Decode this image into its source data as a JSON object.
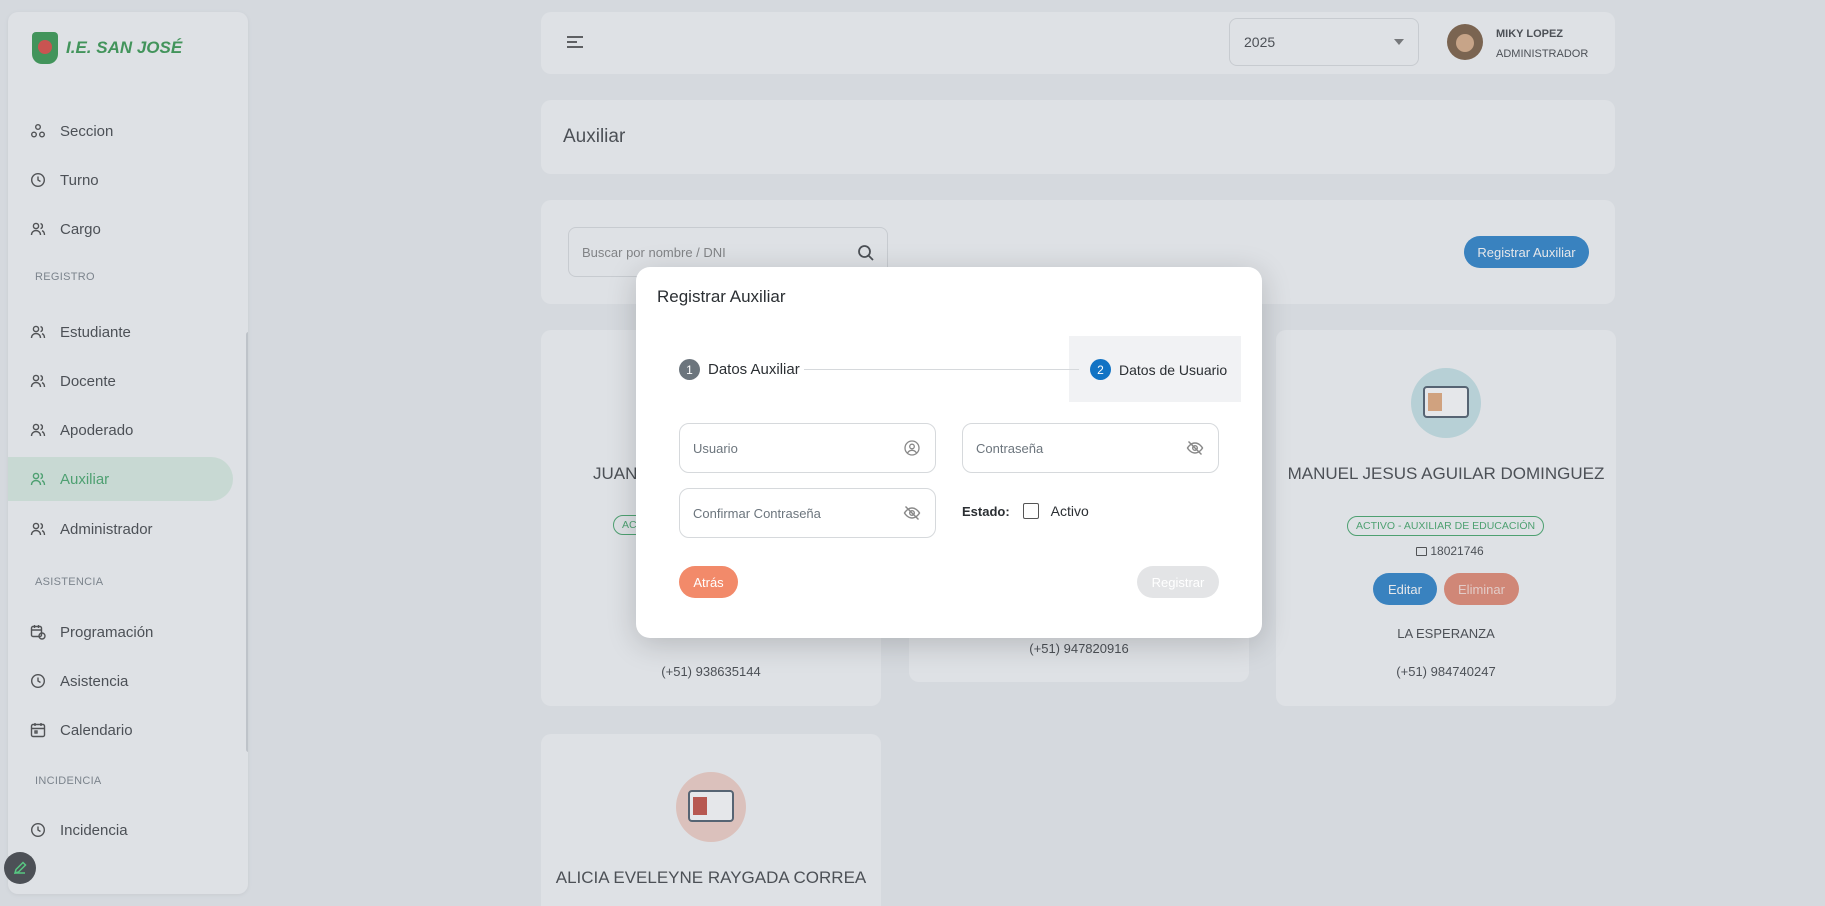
{
  "brand": {
    "name": "I.E. SAN JOSÉ"
  },
  "sidebar": {
    "items": [
      {
        "label": "Seccion",
        "icon": "sections-icon"
      },
      {
        "label": "Turno",
        "icon": "clock-icon"
      },
      {
        "label": "Cargo",
        "icon": "users-icon"
      }
    ],
    "sections": [
      "REGISTRO",
      "ASISTENCIA",
      "INCIDENCIA"
    ],
    "registro": [
      {
        "label": "Estudiante",
        "icon": "users-icon"
      },
      {
        "label": "Docente",
        "icon": "users-icon"
      },
      {
        "label": "Apoderado",
        "icon": "users-icon"
      },
      {
        "label": "Auxiliar",
        "icon": "users-icon",
        "active": true
      },
      {
        "label": "Administrador",
        "icon": "users-icon"
      }
    ],
    "asistencia": [
      {
        "label": "Programación",
        "icon": "calendar-clock-icon"
      },
      {
        "label": "Asistencia",
        "icon": "clock-icon"
      },
      {
        "label": "Calendario",
        "icon": "calendar-icon"
      }
    ],
    "incidencia": [
      {
        "label": "Incidencia",
        "icon": "clock-icon"
      }
    ]
  },
  "topbar": {
    "year": "2025",
    "user_name": "MIKY LOPEZ",
    "user_role": "ADMINISTRADOR"
  },
  "page": {
    "title": "Auxiliar"
  },
  "search": {
    "placeholder": "Buscar por nombre / DNI",
    "register_button": "Registrar Auxiliar"
  },
  "cards": [
    {
      "name_partial": "JUAN",
      "badge_partial": "AC",
      "phone": "(+51) 938635144"
    },
    {
      "phone": "(+51) 947820916"
    },
    {
      "name": "MANUEL JESUS AGUILAR DOMINGUEZ",
      "badge": "ACTIVO - AUXILIAR DE EDUCACIÓN",
      "dni": "18021746",
      "edit": "Editar",
      "delete": "Eliminar",
      "address": "LA ESPERANZA",
      "phone": "(+51) 984740247"
    },
    {
      "name": "ALICIA EVELEYNE RAYGADA CORREA"
    }
  ],
  "modal": {
    "title": "Registrar Auxiliar",
    "step1_num": "1",
    "step1_label": "Datos Auxiliar",
    "step2_num": "2",
    "step2_label": "Datos de Usuario",
    "usuario_placeholder": "Usuario",
    "contrasena_placeholder": "Contraseña",
    "confirmar_placeholder": "Confirmar Contraseña",
    "estado_label": "Estado:",
    "activo_label": "Activo",
    "back_button": "Atrás",
    "submit_button": "Registrar"
  },
  "colors": {
    "brand_green": "#1e8c3a",
    "primary_blue": "#1173c4",
    "danger": "#e27a60",
    "active_green": "#2e9d58"
  }
}
